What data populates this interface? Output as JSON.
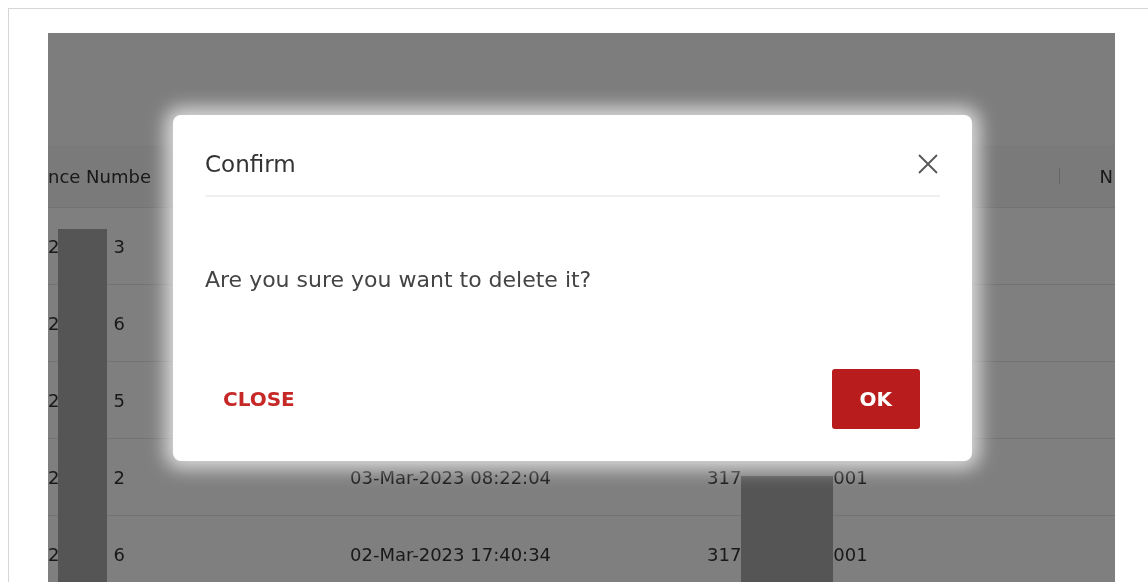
{
  "table": {
    "columns": [
      {
        "label": "nce Numbe"
      },
      {
        "label": "N"
      }
    ],
    "rows": [
      {
        "ref_start": "2",
        "ref_end": "3"
      },
      {
        "ref_start": "2",
        "ref_end": "6"
      },
      {
        "ref_start": "2",
        "ref_end": "5"
      },
      {
        "ref_start": "2",
        "ref_end": "2",
        "date": "03-Mar-2023 08:22:04",
        "account_start": "317",
        "account_end": "001"
      },
      {
        "ref_start": "2",
        "ref_end": "6",
        "date": "02-Mar-2023 17:40:34",
        "account_start": "317",
        "account_end": "001"
      }
    ]
  },
  "dialog": {
    "title": "Confirm",
    "message": "Are you sure you want to delete it?",
    "buttons": [
      {
        "label": "CLOSE",
        "kind": "text"
      },
      {
        "label": "OK",
        "kind": "primary"
      }
    ]
  }
}
